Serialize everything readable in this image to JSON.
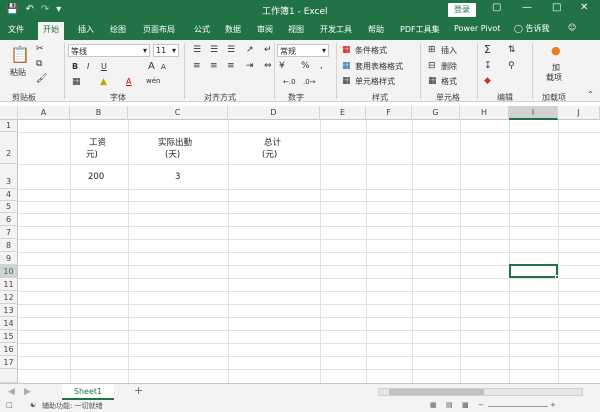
{
  "titlebar": {
    "doc_title": "工作簿1 - Excel",
    "login": "登录"
  },
  "tabs": [
    "文件",
    "开始",
    "插入",
    "绘图",
    "页面布局",
    "公式",
    "数据",
    "审阅",
    "视图",
    "开发工具",
    "帮助",
    "PDF工具集",
    "Power Pivot"
  ],
  "active_tab": "开始",
  "tell_me": "告诉我",
  "ribbon": {
    "clipboard": {
      "paste": "粘贴",
      "label": "剪贴板"
    },
    "font": {
      "name": "等线",
      "size": "11",
      "bold": "B",
      "italic": "I",
      "underline": "U",
      "grow": "A",
      "shrink": "A",
      "wen": "wén",
      "color_a": "A",
      "label": "字体"
    },
    "alignment": {
      "label": "对齐方式"
    },
    "number": {
      "format": "常规",
      "label": "数字"
    },
    "styles": {
      "cond": "条件格式",
      "table": "套用表格格式",
      "cell": "单元格样式",
      "label": "样式"
    },
    "cells": {
      "insert": "插入",
      "delete": "删除",
      "format": "格式",
      "label": "单元格"
    },
    "editing": {
      "sigma": "Σ",
      "label": "编辑"
    },
    "addins": {
      "add": "加",
      "load": "载项",
      "label": "加载项"
    }
  },
  "columns": [
    "A",
    "B",
    "C",
    "D",
    "E",
    "F",
    "G",
    "H",
    "I",
    "J"
  ],
  "rows": [
    "1",
    "2",
    "3",
    "4",
    "5",
    "6",
    "7",
    "8",
    "9",
    "10",
    "11",
    "12",
    "13",
    "14",
    "15",
    "16",
    "17"
  ],
  "cells": {
    "b2_line1": "工资",
    "b2_line2": "元)",
    "c2_line1": "实际出勤",
    "c2_line2": "(天)",
    "d2_line1": "总计",
    "d2_line2": "(元)",
    "b3": "200",
    "c3": "3"
  },
  "sheet": {
    "name": "Sheet1",
    "add": "+"
  },
  "status": {
    "accessibility": "辅助功能: 一切就绪"
  }
}
